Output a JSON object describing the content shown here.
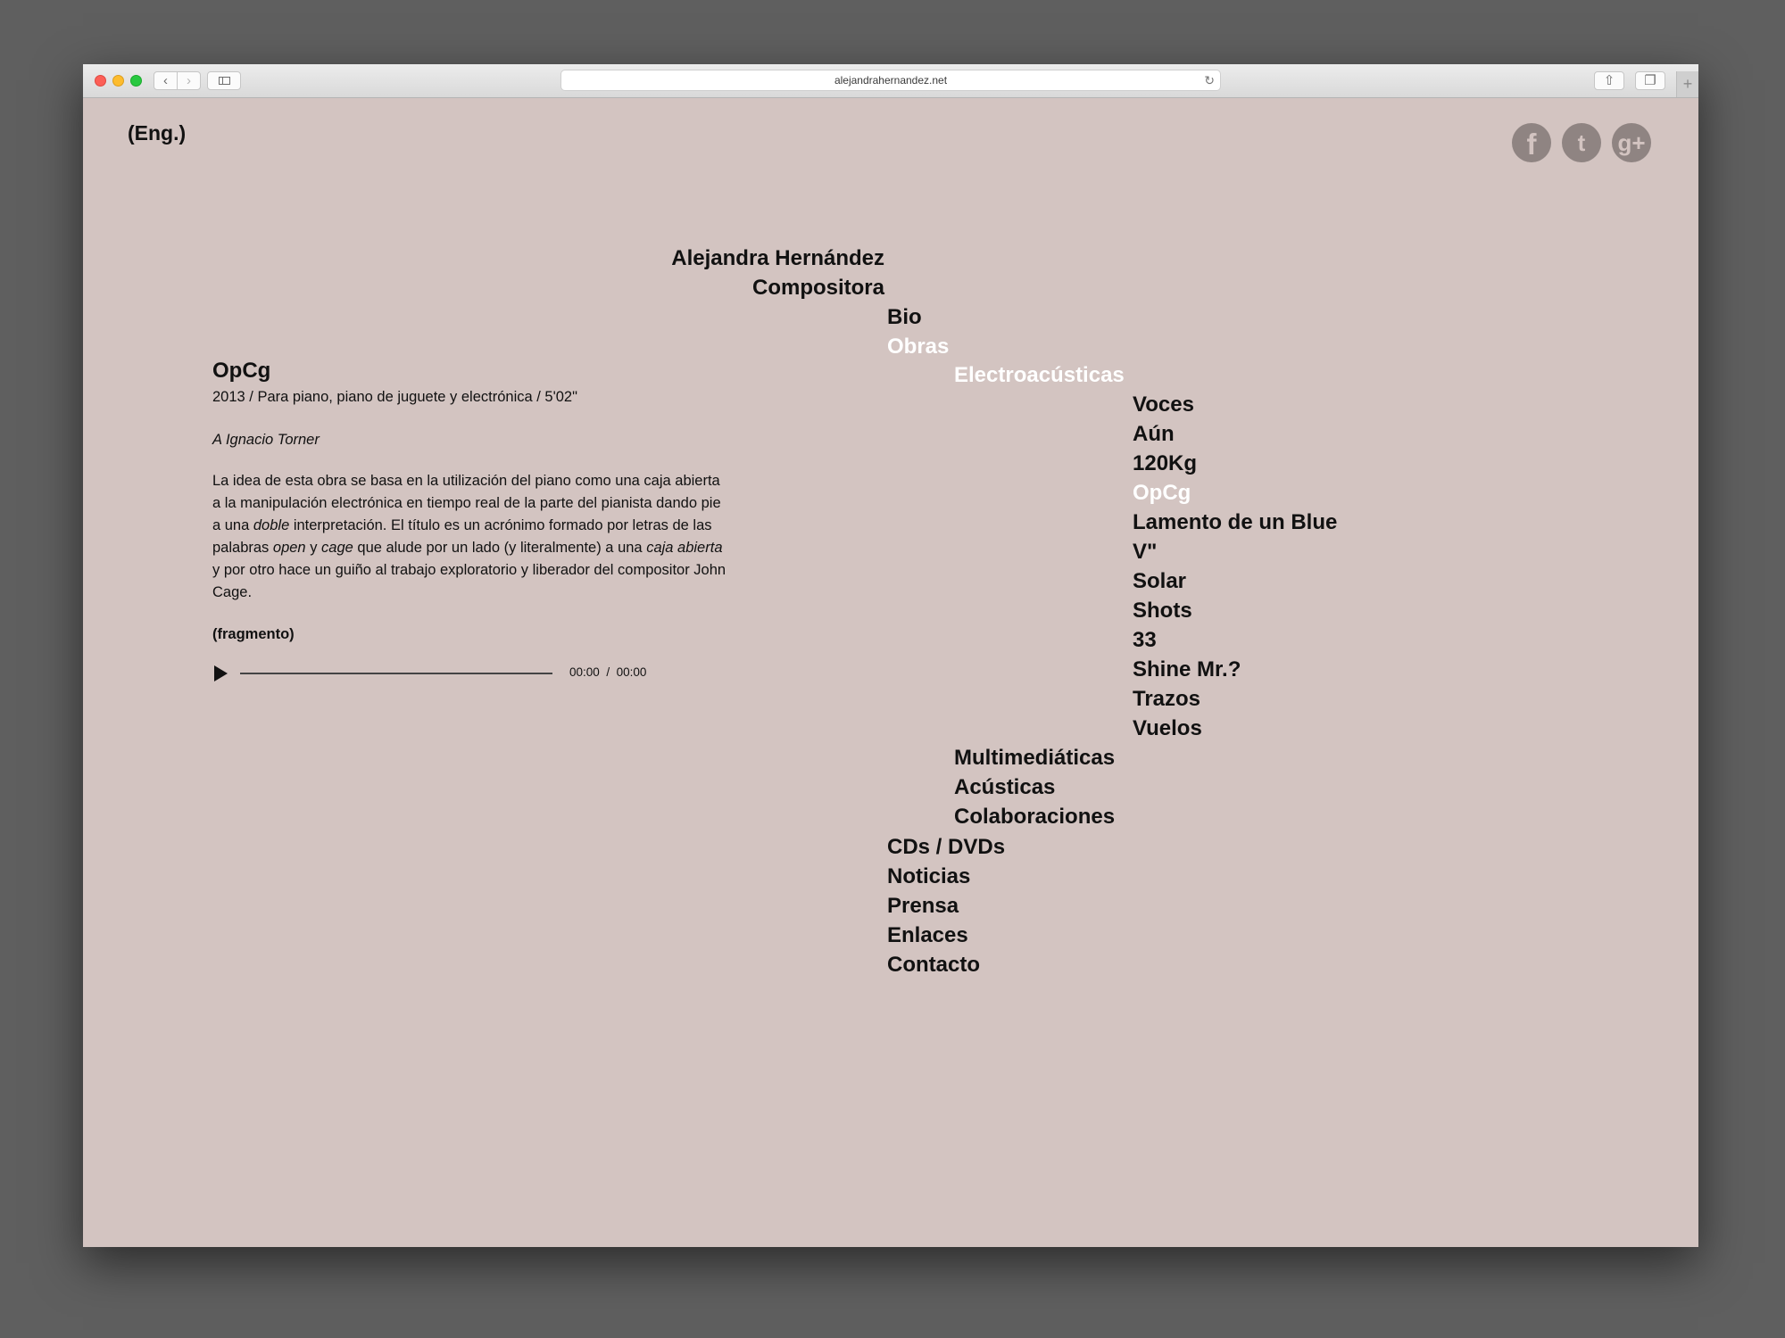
{
  "browser": {
    "url": "alejandrahernandez.net",
    "back_glyph": "‹",
    "forward_glyph": "›",
    "reload_glyph": "↻",
    "share_glyph": "⇧",
    "tabs_glyph": "❐",
    "plus_glyph": "+"
  },
  "header": {
    "lang_toggle": "(Eng.)",
    "social": [
      {
        "name": "facebook",
        "glyph": "f"
      },
      {
        "name": "twitter",
        "glyph": "t"
      },
      {
        "name": "google-plus",
        "glyph": "g+"
      }
    ]
  },
  "site": {
    "title": "Alejandra Hernández",
    "subtitle": "Compositora"
  },
  "menu": {
    "bio": "Bio",
    "obras": "Obras",
    "electroacusticas": "Electroacústicas",
    "works": [
      "Voces",
      "Aún",
      "120Kg",
      "OpCg",
      "Lamento de un Blue",
      "V\"",
      "Solar",
      "Shots",
      "33",
      "Shine Mr.?",
      "Trazos",
      "Vuelos"
    ],
    "active_work": "OpCg",
    "multimediaticas": "Multimediáticas",
    "acusticas": "Acústicas",
    "colaboraciones": "Colaboraciones",
    "cds": "CDs / DVDs",
    "noticias": "Noticias",
    "prensa": "Prensa",
    "enlaces": "Enlaces",
    "contacto": "Contacto"
  },
  "work": {
    "title": "OpCg",
    "meta": "2013 / Para piano, piano de juguete y electrónica / 5'02\"",
    "dedication": "A Ignacio Torner",
    "description": {
      "p1": "La idea de esta obra se basa en la utilización del piano como una caja abierta a la manipulación electrónica en tiempo real de la parte del pianista dando pie a una ",
      "em1": "doble",
      "p2": " interpretación. El título es un acrónimo formado por letras de las palabras ",
      "em2": "open",
      "p3": " y ",
      "em3": "cage",
      "p4": " que alude por un lado (y literalmente) a una ",
      "em4": "caja abierta",
      "p5": " y por otro hace un guiño al trabajo exploratorio y liberador del compositor John Cage."
    },
    "fragment_label": "(fragmento)"
  },
  "player": {
    "current": "00:00",
    "separator": "/",
    "duration": "00:00",
    "progress": 0
  },
  "colors": {
    "page_bg": "#d3c4c1",
    "active": "#ffffff",
    "text": "#111111",
    "social": "#8f8482"
  }
}
